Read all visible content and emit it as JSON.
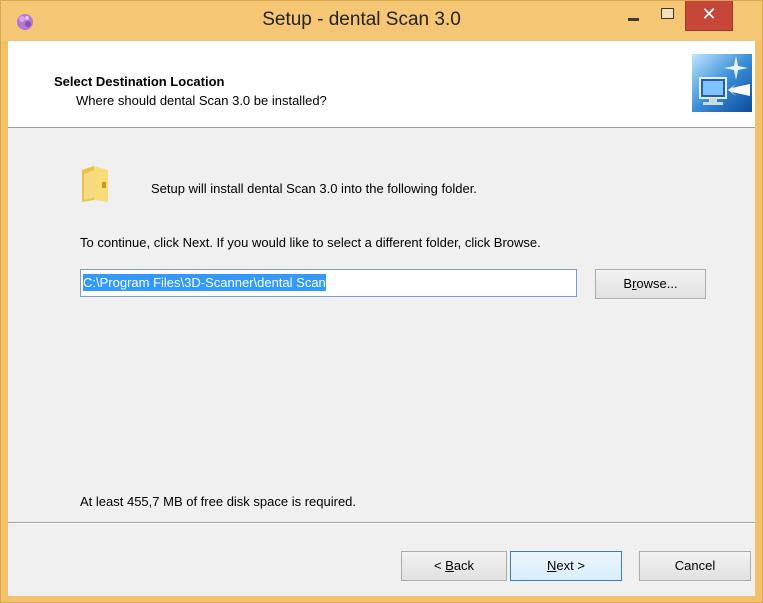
{
  "window": {
    "title": "Setup - dental Scan 3.0",
    "close_glyph": "✕"
  },
  "header": {
    "title": "Select Destination Location",
    "subtitle": "Where should dental Scan 3.0 be installed?"
  },
  "body": {
    "intro": "Setup will install dental Scan 3.0 into the following folder.",
    "instruction": "To continue, click Next. If you would like to select a different folder, click Browse.",
    "path_value": "C:\\Program Files\\3D-Scanner\\dental Scan",
    "browse_label_pre": "B",
    "browse_label_mnemonic": "r",
    "browse_label_post": "owse...",
    "disk_space": "At least 455,7 MB of free disk space is required."
  },
  "footer": {
    "back_prefix": "< ",
    "back_mnemonic": "B",
    "back_rest": "ack",
    "next_mnemonic": "N",
    "next_rest": "ext >",
    "cancel_label": "Cancel"
  },
  "colors": {
    "titlebar": "#f5c674",
    "close": "#c7463a",
    "selection": "#3399ff"
  }
}
